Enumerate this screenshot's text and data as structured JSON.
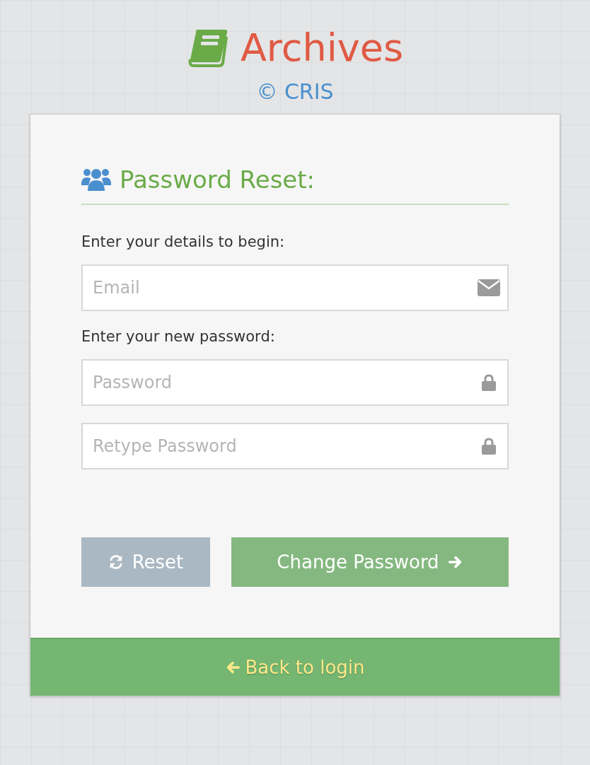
{
  "brand": {
    "title": "Archives",
    "subtitle": "© CRIS"
  },
  "form": {
    "heading": "Password Reset:",
    "sections": [
      {
        "label": "Enter your details to begin:",
        "fields": [
          {
            "placeholder": "Email",
            "kind": "email"
          }
        ]
      },
      {
        "label": "Enter your new password:",
        "fields": [
          {
            "placeholder": "Password",
            "kind": "lock"
          },
          {
            "placeholder": "Retype Password",
            "kind": "lock"
          }
        ]
      }
    ],
    "buttons": [
      {
        "label": "Reset",
        "kind": "reset"
      },
      {
        "label": "Change Password",
        "kind": "submit"
      }
    ]
  },
  "footer": {
    "link": "Back to login"
  }
}
